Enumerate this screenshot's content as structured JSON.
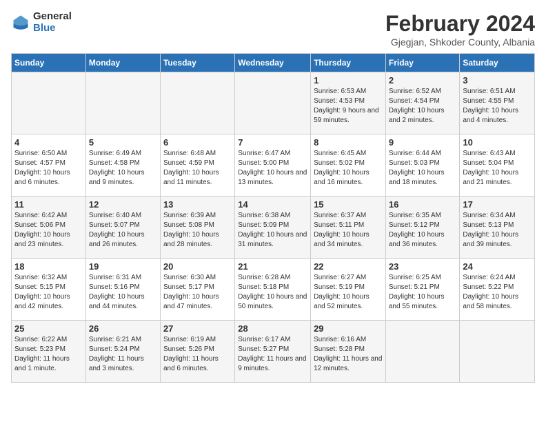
{
  "logo": {
    "general": "General",
    "blue": "Blue"
  },
  "title": "February 2024",
  "subtitle": "Gjegjan, Shkoder County, Albania",
  "days_of_week": [
    "Sunday",
    "Monday",
    "Tuesday",
    "Wednesday",
    "Thursday",
    "Friday",
    "Saturday"
  ],
  "weeks": [
    [
      {
        "day": "",
        "info": ""
      },
      {
        "day": "",
        "info": ""
      },
      {
        "day": "",
        "info": ""
      },
      {
        "day": "",
        "info": ""
      },
      {
        "day": "1",
        "info": "Sunrise: 6:53 AM\nSunset: 4:53 PM\nDaylight: 9 hours and 59 minutes."
      },
      {
        "day": "2",
        "info": "Sunrise: 6:52 AM\nSunset: 4:54 PM\nDaylight: 10 hours and 2 minutes."
      },
      {
        "day": "3",
        "info": "Sunrise: 6:51 AM\nSunset: 4:55 PM\nDaylight: 10 hours and 4 minutes."
      }
    ],
    [
      {
        "day": "4",
        "info": "Sunrise: 6:50 AM\nSunset: 4:57 PM\nDaylight: 10 hours and 6 minutes."
      },
      {
        "day": "5",
        "info": "Sunrise: 6:49 AM\nSunset: 4:58 PM\nDaylight: 10 hours and 9 minutes."
      },
      {
        "day": "6",
        "info": "Sunrise: 6:48 AM\nSunset: 4:59 PM\nDaylight: 10 hours and 11 minutes."
      },
      {
        "day": "7",
        "info": "Sunrise: 6:47 AM\nSunset: 5:00 PM\nDaylight: 10 hours and 13 minutes."
      },
      {
        "day": "8",
        "info": "Sunrise: 6:45 AM\nSunset: 5:02 PM\nDaylight: 10 hours and 16 minutes."
      },
      {
        "day": "9",
        "info": "Sunrise: 6:44 AM\nSunset: 5:03 PM\nDaylight: 10 hours and 18 minutes."
      },
      {
        "day": "10",
        "info": "Sunrise: 6:43 AM\nSunset: 5:04 PM\nDaylight: 10 hours and 21 minutes."
      }
    ],
    [
      {
        "day": "11",
        "info": "Sunrise: 6:42 AM\nSunset: 5:06 PM\nDaylight: 10 hours and 23 minutes."
      },
      {
        "day": "12",
        "info": "Sunrise: 6:40 AM\nSunset: 5:07 PM\nDaylight: 10 hours and 26 minutes."
      },
      {
        "day": "13",
        "info": "Sunrise: 6:39 AM\nSunset: 5:08 PM\nDaylight: 10 hours and 28 minutes."
      },
      {
        "day": "14",
        "info": "Sunrise: 6:38 AM\nSunset: 5:09 PM\nDaylight: 10 hours and 31 minutes."
      },
      {
        "day": "15",
        "info": "Sunrise: 6:37 AM\nSunset: 5:11 PM\nDaylight: 10 hours and 34 minutes."
      },
      {
        "day": "16",
        "info": "Sunrise: 6:35 AM\nSunset: 5:12 PM\nDaylight: 10 hours and 36 minutes."
      },
      {
        "day": "17",
        "info": "Sunrise: 6:34 AM\nSunset: 5:13 PM\nDaylight: 10 hours and 39 minutes."
      }
    ],
    [
      {
        "day": "18",
        "info": "Sunrise: 6:32 AM\nSunset: 5:15 PM\nDaylight: 10 hours and 42 minutes."
      },
      {
        "day": "19",
        "info": "Sunrise: 6:31 AM\nSunset: 5:16 PM\nDaylight: 10 hours and 44 minutes."
      },
      {
        "day": "20",
        "info": "Sunrise: 6:30 AM\nSunset: 5:17 PM\nDaylight: 10 hours and 47 minutes."
      },
      {
        "day": "21",
        "info": "Sunrise: 6:28 AM\nSunset: 5:18 PM\nDaylight: 10 hours and 50 minutes."
      },
      {
        "day": "22",
        "info": "Sunrise: 6:27 AM\nSunset: 5:19 PM\nDaylight: 10 hours and 52 minutes."
      },
      {
        "day": "23",
        "info": "Sunrise: 6:25 AM\nSunset: 5:21 PM\nDaylight: 10 hours and 55 minutes."
      },
      {
        "day": "24",
        "info": "Sunrise: 6:24 AM\nSunset: 5:22 PM\nDaylight: 10 hours and 58 minutes."
      }
    ],
    [
      {
        "day": "25",
        "info": "Sunrise: 6:22 AM\nSunset: 5:23 PM\nDaylight: 11 hours and 1 minute."
      },
      {
        "day": "26",
        "info": "Sunrise: 6:21 AM\nSunset: 5:24 PM\nDaylight: 11 hours and 3 minutes."
      },
      {
        "day": "27",
        "info": "Sunrise: 6:19 AM\nSunset: 5:26 PM\nDaylight: 11 hours and 6 minutes."
      },
      {
        "day": "28",
        "info": "Sunrise: 6:17 AM\nSunset: 5:27 PM\nDaylight: 11 hours and 9 minutes."
      },
      {
        "day": "29",
        "info": "Sunrise: 6:16 AM\nSunset: 5:28 PM\nDaylight: 11 hours and 12 minutes."
      },
      {
        "day": "",
        "info": ""
      },
      {
        "day": "",
        "info": ""
      }
    ]
  ]
}
